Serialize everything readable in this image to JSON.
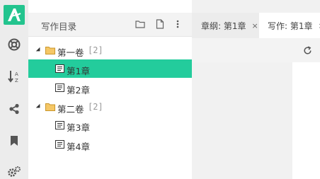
{
  "sidebar": {
    "icons": [
      "logo-icon",
      "lifebuoy-icon",
      "sort-az-icon",
      "share-icon",
      "bookmark-icon",
      "settings-icon"
    ]
  },
  "panel": {
    "title": "写作目录",
    "actions": [
      "folder-icon",
      "file-icon",
      "more-icon"
    ],
    "tree": [
      {
        "type": "volume",
        "label": "第一卷",
        "count": "[2]"
      },
      {
        "type": "chapter",
        "label": "第1章",
        "selected": true
      },
      {
        "type": "chapter",
        "label": "第2章"
      },
      {
        "type": "volume",
        "label": "第二卷",
        "count": "[2]"
      },
      {
        "type": "chapter",
        "label": "第3章"
      },
      {
        "type": "chapter",
        "label": "第4章"
      }
    ]
  },
  "tabs": [
    {
      "label": "章纲: 第1章",
      "close": "×",
      "active": false
    },
    {
      "label": "写作: 第1章",
      "close": "×",
      "active": true
    }
  ],
  "colors": {
    "accent": "#23cc9c",
    "logo": "#23c48e"
  }
}
